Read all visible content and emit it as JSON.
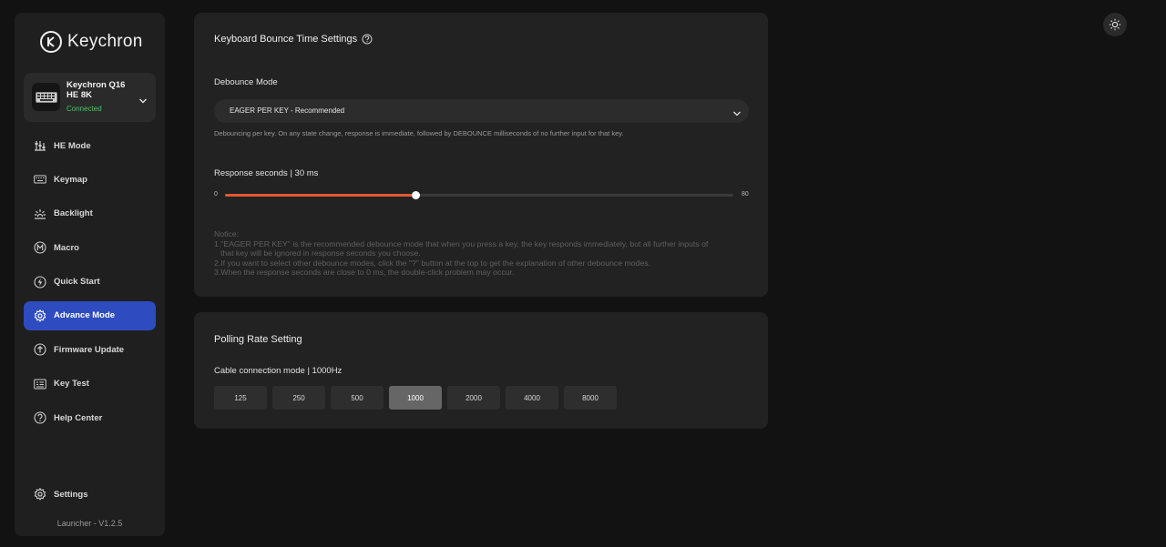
{
  "sidebar": {
    "logo_text": "Keychron",
    "device": {
      "name": "Keychron Q16 HE 8K",
      "status": "Connected"
    },
    "nav": [
      {
        "label": "HE Mode",
        "icon": "he-mode-icon"
      },
      {
        "label": "Keymap",
        "icon": "keyboard-icon"
      },
      {
        "label": "Backlight",
        "icon": "backlight-icon"
      },
      {
        "label": "Macro",
        "icon": "macro-icon"
      },
      {
        "label": "Quick Start",
        "icon": "quick-start-icon"
      },
      {
        "label": "Advance Mode",
        "icon": "gear-icon",
        "active": true
      },
      {
        "label": "Firmware Update",
        "icon": "upload-icon"
      },
      {
        "label": "Key Test",
        "icon": "key-test-icon"
      },
      {
        "label": "Help Center",
        "icon": "help-icon"
      }
    ],
    "settings_label": "Settings",
    "version": "Launcher - V1.2.5"
  },
  "debounce": {
    "title": "Keyboard Bounce Time Settings",
    "mode_label": "Debounce Mode",
    "mode_value": "EAGER PER KEY - Recommended",
    "description": "Debouncing per key. On any state change, response is immediate, followed by DEBOUNCE milliseconds of no further input for that key.",
    "response_label": "Response seconds | 30 ms",
    "slider": {
      "min": 0,
      "max": 80,
      "value": 30,
      "min_label": "0",
      "max_label": "80"
    },
    "notice": {
      "heading": "Notice:",
      "line1a": "1.\"EAGER PER KEY\" is the recommended debounce mode that when you press a key, the key responds immediately, but all further inputs of",
      "line1b": "that key will be ignored in response seconds you choose.",
      "line2": "2.If you want to select other debounce modes, click the \"?\" button at the top to get the explanation of other debounce modes.",
      "line3": "3.When the response seconds are close to 0 ms, the double-click problem may occur."
    }
  },
  "polling": {
    "title": "Polling Rate Setting",
    "label": "Cable connection mode | 1000Hz",
    "rates": [
      "125",
      "250",
      "500",
      "1000",
      "2000",
      "4000",
      "8000"
    ],
    "selected": "1000"
  },
  "colors": {
    "accent": "#2f4bc0",
    "slider_fill": "#e2582f",
    "connected": "#4cc46a"
  }
}
